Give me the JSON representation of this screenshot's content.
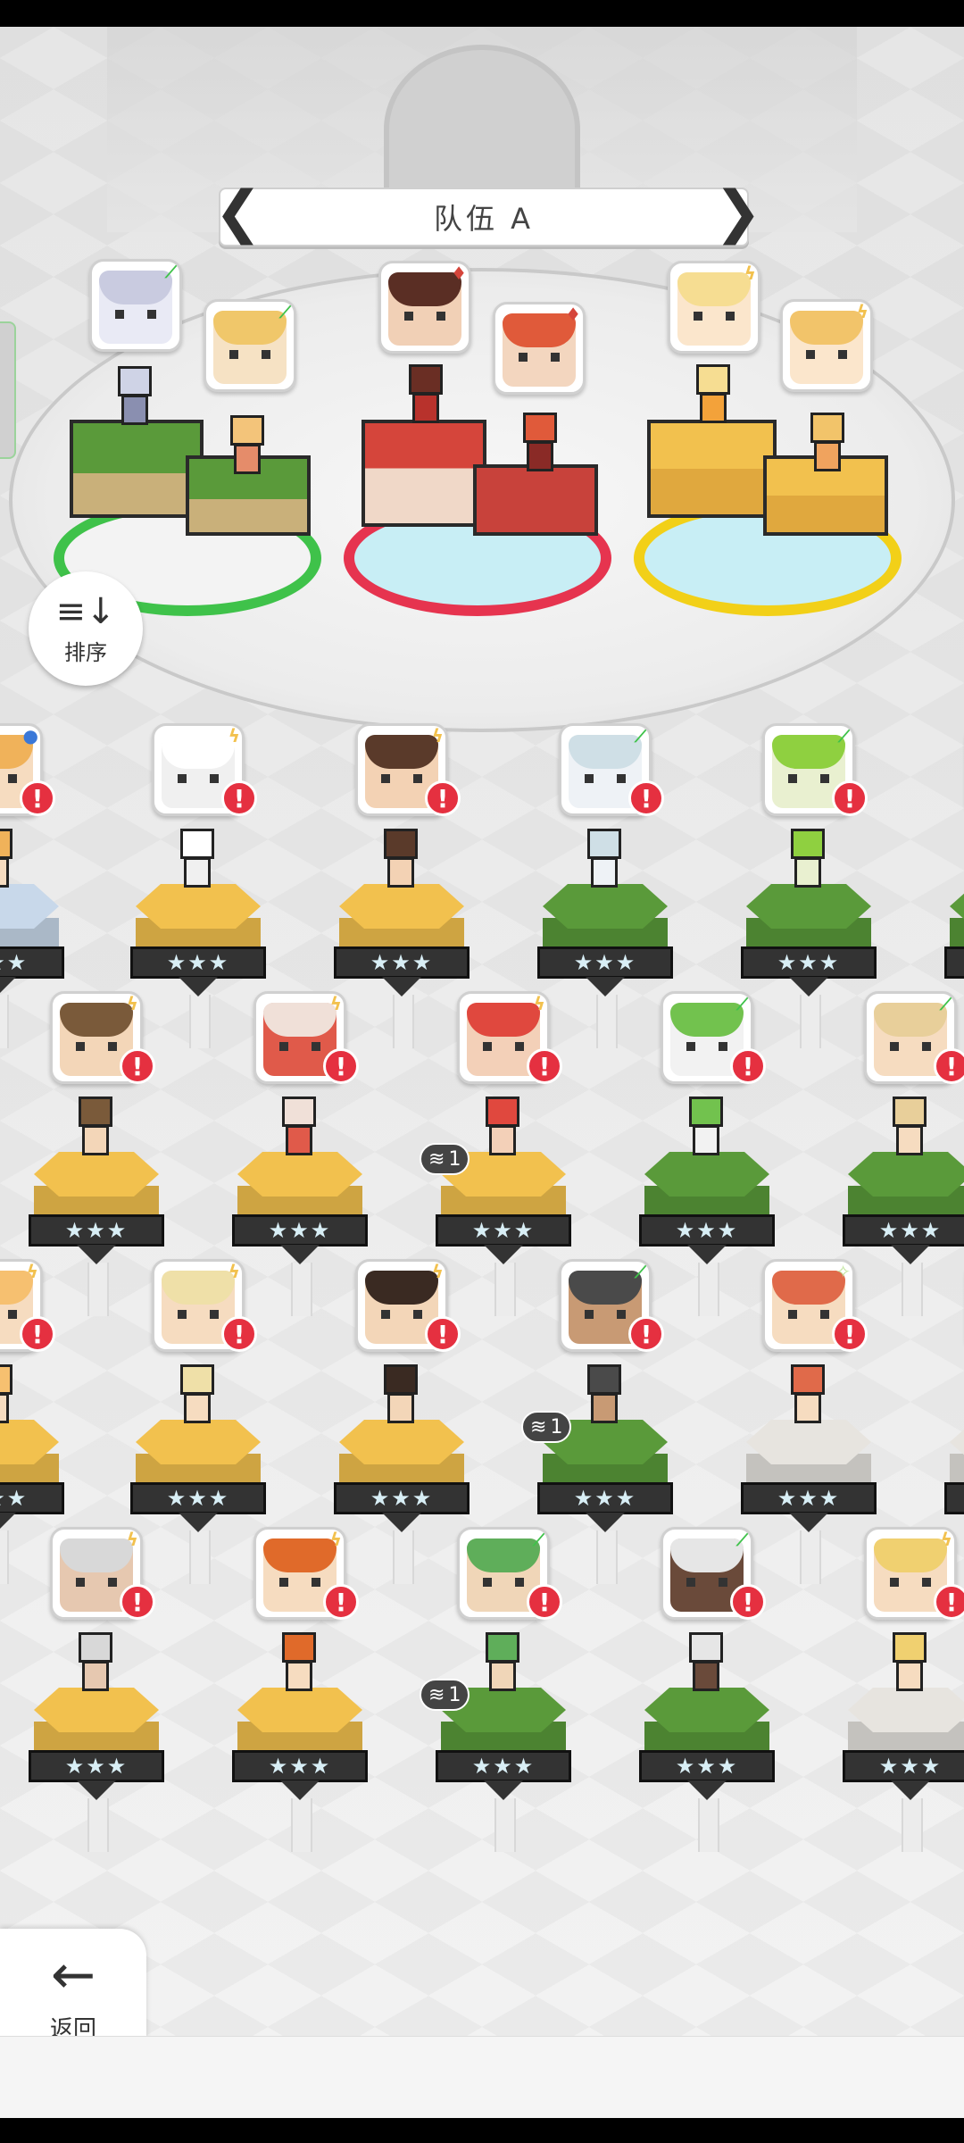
{
  "team": {
    "title": "队伍 A",
    "prev_label": "❮",
    "next_label": "❯"
  },
  "sort_button": {
    "label": "排序",
    "icon": "≡↓"
  },
  "back_button": {
    "label": "返回",
    "icon": "←"
  },
  "stars": "★★★",
  "alert_mark": "!",
  "stack_badges": [
    {
      "icon": "≋",
      "count": "1"
    },
    {
      "icon": "≋",
      "count": "1"
    },
    {
      "icon": "≋",
      "count": "1"
    }
  ],
  "element_icons": {
    "leaf": "leaf-icon",
    "lightning": "lightning-icon",
    "fire": "fire-icon",
    "sparkle": "sparkle-icon",
    "water": "water-icon"
  },
  "colors": {
    "grass": "#5a9a3a",
    "fire": "#d5453b",
    "thunder": "#f2c14e",
    "neutral": "#e7e4df",
    "alert": "#e53040",
    "ring_green": "#3fc24a",
    "ring_red": "#e6344f",
    "ring_yellow": "#f2d018"
  },
  "team_slots": [
    {
      "element": "leaf",
      "glyph": "⟋"
    },
    {
      "element": "leaf",
      "glyph": "⟋"
    },
    {
      "element": "fire",
      "glyph": "♦"
    },
    {
      "element": "fire",
      "glyph": "♦"
    },
    {
      "element": "lightning",
      "glyph": "ϟ"
    },
    {
      "element": "lightning",
      "glyph": "ϟ"
    }
  ],
  "roster_glyphs": {
    "leaf": "⟋",
    "lightning": "ϟ",
    "sparkle": "✧",
    "water": "●"
  }
}
